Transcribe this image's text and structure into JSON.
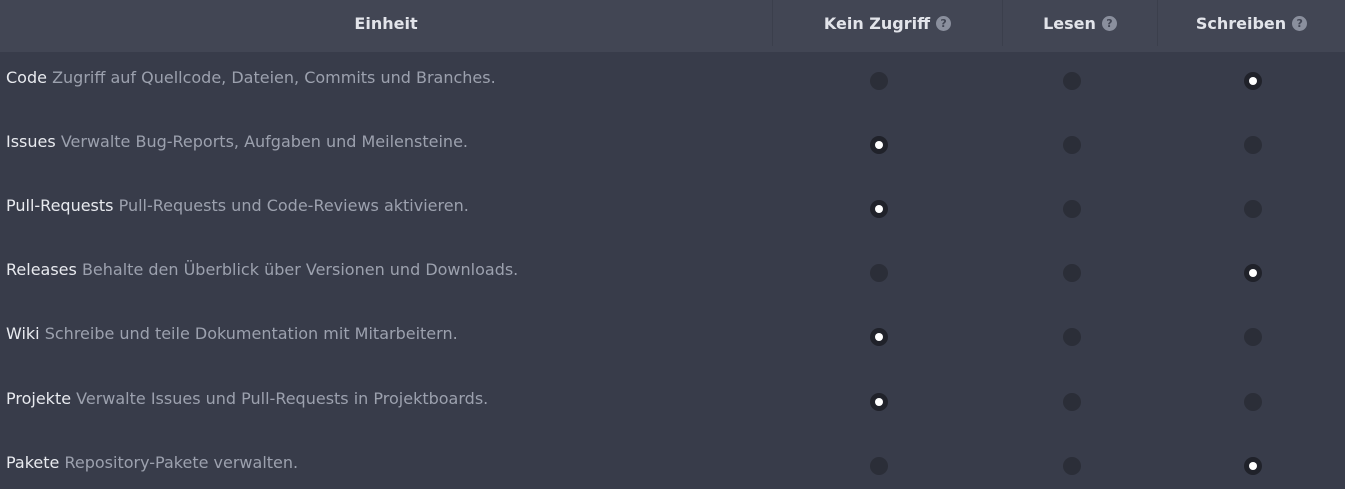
{
  "header": {
    "unit": "Einheit",
    "none": "Kein Zugriff",
    "read": "Lesen",
    "write": "Schreiben",
    "help_glyph": "?"
  },
  "rows": [
    {
      "name": "Code",
      "desc": "Zugriff auf Quellcode, Dateien, Commits und Branches.",
      "selected": "write"
    },
    {
      "name": "Issues",
      "desc": "Verwalte Bug-Reports, Aufgaben und Meilensteine.",
      "selected": "none"
    },
    {
      "name": "Pull-Requests",
      "desc": "Pull-Requests und Code-Reviews aktivieren.",
      "selected": "none"
    },
    {
      "name": "Releases",
      "desc": "Behalte den Überblick über Versionen und Downloads.",
      "selected": "write"
    },
    {
      "name": "Wiki",
      "desc": "Schreibe und teile Dokumentation mit Mitarbeitern.",
      "selected": "none"
    },
    {
      "name": "Projekte",
      "desc": "Verwalte Issues und Pull-Requests in Projektboards.",
      "selected": "none"
    },
    {
      "name": "Pakete",
      "desc": "Repository-Pakete verwalten.",
      "selected": "write"
    }
  ]
}
